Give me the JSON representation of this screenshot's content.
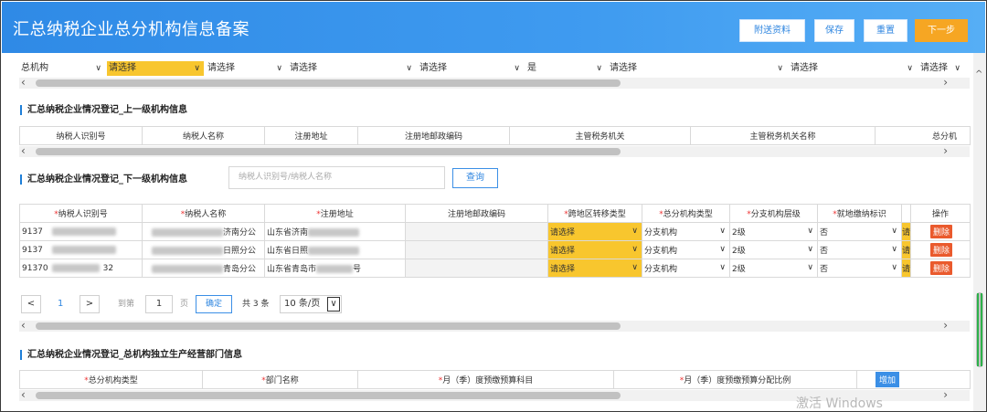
{
  "header": {
    "title": "汇总纳税企业总分机构信息备案",
    "buttons": {
      "attach": "附送资料",
      "save": "保存",
      "reset": "重置",
      "next": "下一步"
    }
  },
  "top_row": {
    "selects": [
      {
        "value": "总机构",
        "highlight": false
      },
      {
        "value": "请选择",
        "highlight": true
      },
      {
        "value": "请选择",
        "highlight": false
      },
      {
        "value": "请选择",
        "highlight": false
      },
      {
        "value": "请选择",
        "highlight": false
      },
      {
        "value": "是",
        "highlight": false
      },
      {
        "value": "请选择",
        "highlight": false
      },
      {
        "value": "请选择",
        "highlight": false
      },
      {
        "value": "请选择",
        "highlight": false
      }
    ]
  },
  "section_upper": {
    "title": "汇总纳税企业情况登记_上一级机构信息",
    "columns": [
      "纳税人识别号",
      "纳税人名称",
      "注册地址",
      "注册地邮政编码",
      "主管税务机关",
      "主管税务机关名称",
      "总分机"
    ]
  },
  "section_lower": {
    "title": "汇总纳税企业情况登记_下一级机构信息",
    "search_placeholder": "纳税人识别号/纳税人名称",
    "search_button": "查询",
    "columns": [
      "*纳税人识别号",
      "*纳税人名称",
      "*注册地址",
      "注册地邮政编码",
      "*跨地区转移类型",
      "*总分机构类型",
      "*分支机构层级",
      "*就地缴纳标识",
      "",
      "操作"
    ],
    "rows": [
      {
        "id": "9137",
        "name": "济南分公",
        "address": "山东省济南",
        "postal": "",
        "transfer": "请选择",
        "org_type": "分支机构",
        "level": "2级",
        "local": "否",
        "extra": "请",
        "action": "删除"
      },
      {
        "id": "9137",
        "name": "日照分公",
        "address": "山东省日照",
        "postal": "",
        "transfer": "请选择",
        "org_type": "分支机构",
        "level": "2级",
        "local": "否",
        "extra": "请",
        "action": "删除"
      },
      {
        "id": "91370",
        "id_tail": "32",
        "name": "青岛分公",
        "address": "山东省青岛市",
        "address_tail": "号",
        "postal": "",
        "transfer": "请选择",
        "org_type": "分支机构",
        "level": "2级",
        "local": "否",
        "extra": "请",
        "action": "删除"
      }
    ]
  },
  "pagination": {
    "prev": "<",
    "current": "1",
    "next": ">",
    "goto_label": "到第",
    "page_input": "1",
    "page_unit": "页",
    "confirm": "确定",
    "total": "共 3 条",
    "page_size": "10 条/页"
  },
  "section_dept": {
    "title": "汇总纳税企业情况登记_总机构独立生产经营部门信息",
    "columns": [
      "*总分机构类型",
      "*部门名称",
      "*月（季）度预缴预算科目",
      "*月（季）度预缴预算分配比例"
    ],
    "add_button": "增加"
  },
  "watermark": "激活 Windows",
  "colors": {
    "header": "#2f8ae6",
    "highlight": "#f8c62e",
    "next_button": "#f6a623",
    "delete": "#ea5a2d"
  }
}
